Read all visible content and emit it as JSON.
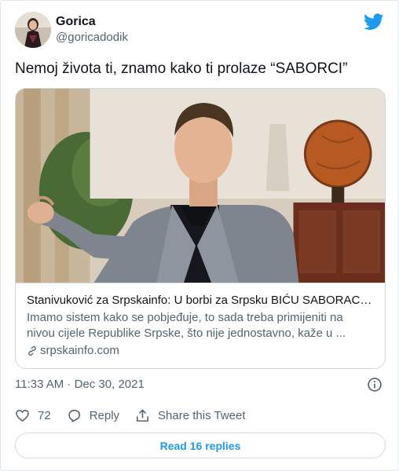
{
  "author": {
    "display_name": "Gorica",
    "handle": "@goricadodik"
  },
  "tweet": {
    "text": "Nemoj života ti, znamo kako ti prolaze “SABORCI”"
  },
  "link_card": {
    "title": "Stanivuković za Srpskainfo: U borbi za Srpsku BIĆU SABORAC SN...",
    "description": "Imamo sistem kako se pobjeđuje, to sada treba primijeniti na nivou cijele Republike Srpske, što nije jednostavno, kaže u ...",
    "domain": "srpskainfo.com"
  },
  "meta": {
    "timestamp": "11:33 AM · Dec 30, 2021"
  },
  "actions": {
    "likes": "72",
    "reply_label": "Reply",
    "share_label": "Share this Tweet"
  },
  "read_replies": "Read 16 replies",
  "colors": {
    "accent": "#1d9bf0",
    "text": "#0f1419",
    "muted": "#536471",
    "border": "#cfd9de"
  },
  "icons": [
    "twitter-bird-icon",
    "link-icon",
    "info-icon",
    "heart-icon",
    "reply-icon",
    "share-icon"
  ]
}
